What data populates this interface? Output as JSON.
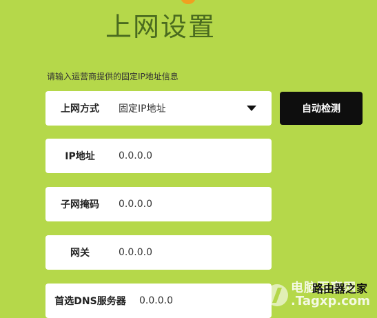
{
  "page": {
    "title": "上网设置",
    "hint": "请输入运营商提供的固定IP地址信息"
  },
  "form": {
    "mode": {
      "label": "上网方式",
      "value": "固定IP地址"
    },
    "ip": {
      "label": "IP地址",
      "value": "0.0.0.0"
    },
    "mask": {
      "label": "子网掩码",
      "value": "0.0.0.0"
    },
    "gateway": {
      "label": "网关",
      "value": "0.0.0.0"
    },
    "dns1": {
      "label": "首选DNS服务器",
      "value": "0.0.0.0"
    }
  },
  "actions": {
    "detect_label": "自动检测"
  },
  "watermark": {
    "line1": "电脑百事网",
    "line2": ".Tagxp.com",
    "overlay": "路由器之家"
  },
  "colors": {
    "background": "#b5d84a",
    "title": "#4a6b1f",
    "button": "#0e0e0e"
  }
}
